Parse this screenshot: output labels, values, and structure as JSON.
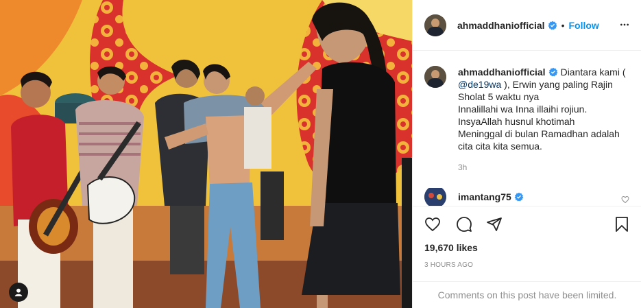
{
  "post": {
    "author": "ahmaddhaniofficial",
    "follow_label": "Follow",
    "dot": "•",
    "caption_lines": {
      "before_mention": "Diantara kami (",
      "mention": "@de19wa",
      "after_mention": "), Erwin yang paling Rajin Sholat 5 waktu nya\nInnalillahi wa Inna illaihi rojiun.\nInsyaAllah husnul khotimah\nMeninggal di bulan Ramadhan adalah cita cita kita semua."
    },
    "caption_time": "3h",
    "comment_user": "imantang75",
    "likes": "19,670 likes",
    "posted_ago": "3 HOURS AGO",
    "comments_limited": "Comments on this post have been limited."
  },
  "icons": {
    "verified": "verified-badge-icon",
    "more": "more-options-icon",
    "like": "heart-icon",
    "comment": "comment-icon",
    "share": "share-icon",
    "save": "bookmark-icon",
    "tag": "user-tag-icon"
  },
  "colors": {
    "link": "#0095f6",
    "mention": "#00376b",
    "muted": "#8e8e8e",
    "text": "#262626",
    "border": "#efefef"
  }
}
